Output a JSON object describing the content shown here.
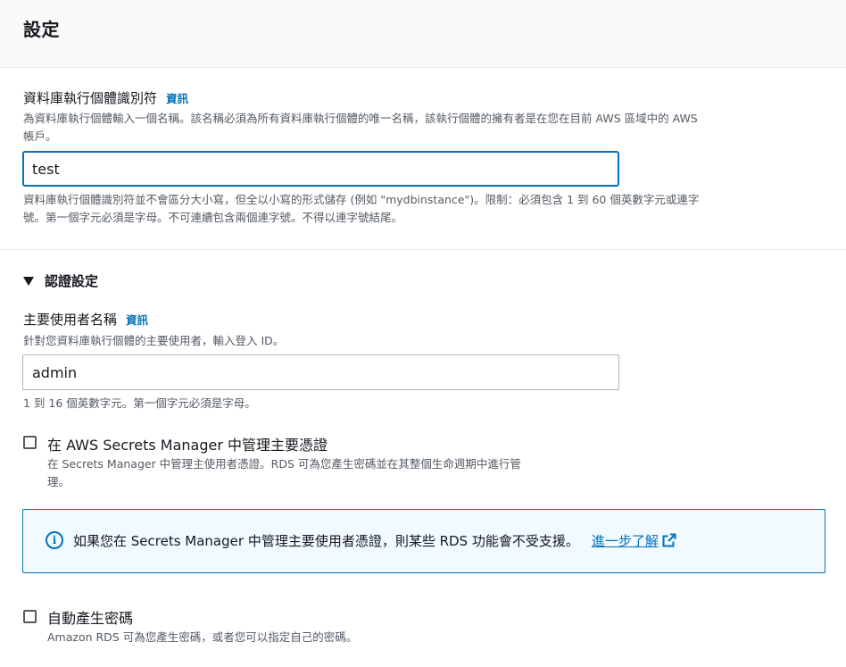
{
  "header": {
    "title": "設定"
  },
  "db_identifier": {
    "label": "資料庫執行個體識別符",
    "info": "資訊",
    "description_line1": "為資料庫執行個體輸入一個名稱。該名稱必須為所有資料庫執行個體的唯一名稱，該執行個體的擁有者是在您在目前 AWS 區域中的 AWS",
    "description_line2": "帳戶。",
    "value": "test",
    "constraint_line1": "資料庫執行個體識別符並不會區分大小寫，但全以小寫的形式儲存 (例如 \"mydbinstance\")。限制：必須包含 1 到 60 個英數字元或連字",
    "constraint_line2": "號。第一個字元必須是字母。不可連續包含兩個連字號。不得以連字號結尾。"
  },
  "credentials": {
    "section_title": "認證設定",
    "expanded": true,
    "master_username": {
      "label": "主要使用者名稱",
      "info": "資訊",
      "description": "針對您資料庫執行個體的主要使用者，輸入登入 ID。",
      "value": "admin",
      "constraint": "1 到 16 個英數字元。第一個字元必須是字母。"
    },
    "secrets_manager": {
      "label": "在 AWS Secrets Manager 中管理主要憑證",
      "checked": false,
      "description_line1": "在 Secrets Manager 中管理主使用者憑證。RDS 可為您產生密碼並在其整個生命週期中進行管",
      "description_line2": "理。"
    },
    "alert": {
      "icon": "info-icon",
      "text": "如果您在 Secrets Manager 中管理主要使用者憑證，則某些 RDS 功能會不受支援。",
      "link": "進一步了解",
      "link_icon": "external-link-icon"
    },
    "auto_password": {
      "label": "自動產生密碼",
      "checked": false,
      "description": "Amazon RDS 可為您產生密碼，或者您可以指定自己的密碼。"
    }
  },
  "colors": {
    "accent": "#0073bb",
    "alert_bg": "#f1faff",
    "text": "#16191f",
    "muted": "#545b64"
  }
}
